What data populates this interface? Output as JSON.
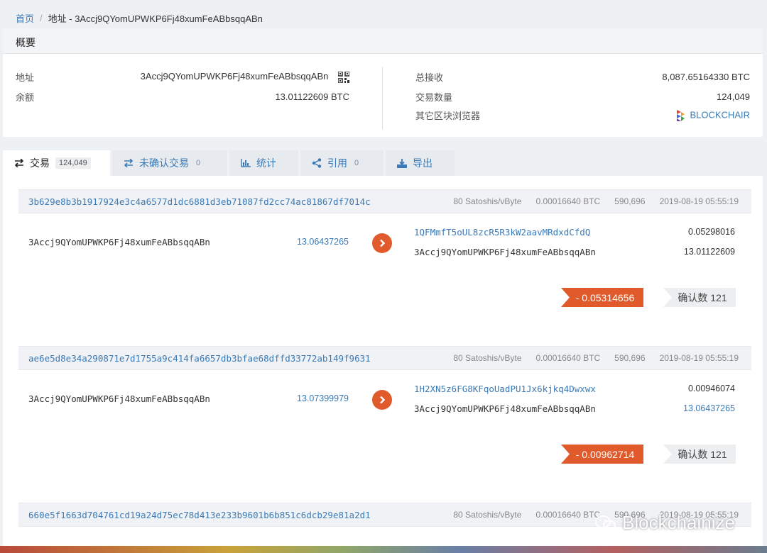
{
  "breadcrumb": {
    "home": "首页",
    "sep": "/",
    "current": "地址 - 3Accj9QYomUPWKP6Fj48xumFeABbsqqABn"
  },
  "overview": {
    "title": "概要",
    "address_label": "地址",
    "address_value": "3Accj9QYomUPWKP6Fj48xumFeABbsqqABn",
    "balance_label": "余额",
    "balance_value": "13.01122609 BTC",
    "total_received_label": "总接收",
    "total_received_value": "8,087.65164330 BTC",
    "tx_count_label": "交易数量",
    "tx_count_value": "124,049",
    "explorers_label": "其它区块浏览器",
    "explorer_name": "BLOCKCHAIR"
  },
  "tabs": [
    {
      "label": "交易",
      "count": "124,049",
      "icon": "transfer-icon"
    },
    {
      "label": "未确认交易",
      "count": "0",
      "icon": "transfer-icon"
    },
    {
      "label": "统计",
      "count": "",
      "icon": "bar-chart-icon"
    },
    {
      "label": "引用",
      "count": "0",
      "icon": "share-icon"
    },
    {
      "label": "导出",
      "count": "",
      "icon": "download-icon"
    }
  ],
  "transactions": [
    {
      "hash": "3b629e8b3b1917924e3c4a6577d1dc6881d3eb71087fd2cc74ac81867df7014c",
      "fee_rate": "80 Satoshis/vByte",
      "fee": "0.00016640 BTC",
      "block": "590,696",
      "time": "2019-08-19 05:55:19",
      "input_address": "3Accj9QYomUPWKP6Fj48xumFeABbsqqABn",
      "input_amount": "13.06437265",
      "outputs": [
        {
          "address": "1QFMmfT5oUL8zcR5R3kW2aavMRdxdCfdQ",
          "amount": "0.05298016"
        },
        {
          "address": "3Accj9QYomUPWKP6Fj48xumFeABbsqqABn",
          "amount": "13.01122609"
        }
      ],
      "delta": "- 0.05314656",
      "confirmations": "确认数 121"
    },
    {
      "hash": "ae6e5d8e34a290871e7d1755a9c414fa6657db3bfae68dffd33772ab149f9631",
      "fee_rate": "80 Satoshis/vByte",
      "fee": "0.00016640 BTC",
      "block": "590,696",
      "time": "2019-08-19 05:55:19",
      "input_address": "3Accj9QYomUPWKP6Fj48xumFeABbsqqABn",
      "input_amount": "13.07399979",
      "outputs": [
        {
          "address": "1H2XN5z6FG8KFqoUadPU1Jx6kjkq4Dwxwx",
          "amount": "0.00946074"
        },
        {
          "address": "3Accj9QYomUPWKP6Fj48xumFeABbsqqABn",
          "amount": "13.06437265"
        }
      ],
      "delta": "- 0.00962714",
      "confirmations": "确认数 121"
    },
    {
      "hash": "660e5f1663d704761cd19a24d75ec78d413e233b9601b6b851c6dcb29e81a2d1",
      "fee_rate": "80 Satoshis/vByte",
      "fee": "0.00016640 BTC",
      "block": "590,696",
      "time": "2019-08-19 05:55:19"
    }
  ],
  "watermark": "Blockchainize",
  "colors": {
    "link": "#3a7ab6",
    "accent": "#e05a2b",
    "background": "#eef1f4"
  }
}
